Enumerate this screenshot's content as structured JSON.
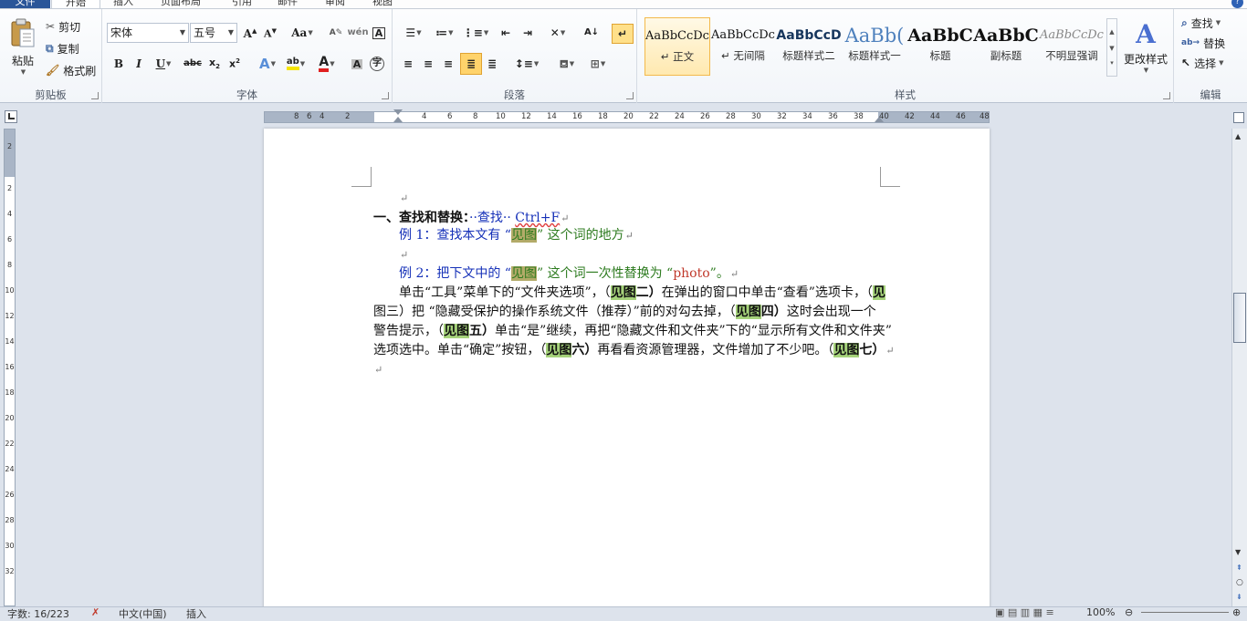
{
  "tabs": {
    "file": "文件",
    "home": "开始",
    "insert": "插入",
    "layout": "页面布局",
    "references": "引用",
    "mailings": "邮件",
    "review": "审阅",
    "view": "视图"
  },
  "clipboard": {
    "label": "剪贴板",
    "paste": "粘贴",
    "cut": "剪切",
    "copy": "复制",
    "format_painter": "格式刷"
  },
  "font": {
    "label": "字体",
    "name": "宋体",
    "size": "五号"
  },
  "paragraph": {
    "label": "段落"
  },
  "styles": {
    "label": "样式",
    "preview_text": [
      "AaBbCcDc",
      "AaBbCcDc",
      "AaBbCcD",
      "AaBb(",
      "AaBbC",
      "AaBbC",
      "AaBbCcDc"
    ],
    "names": [
      "↵ 正文",
      "↵ 无间隔",
      "标题样式二",
      "标题样式一",
      "标题",
      "副标题",
      "不明显强调"
    ],
    "change": "更改样式"
  },
  "editing": {
    "label": "编辑",
    "find": "查找",
    "replace": "替换",
    "select": "选择"
  },
  "doc": {
    "heading": "一、查找和替换：",
    "find_label": "查找",
    "shortcut": "Ctrl+F",
    "ex1_a": "例 1：查找本文有 “",
    "ex1_b": "见图",
    "ex1_c": "” 这个词的地方",
    "ex2_a": "例 2：把下文中的 “",
    "ex2_b": "见图",
    "ex2_c": "” 这个词一次性替换为 “",
    "ex2_d": "photo",
    "ex2_e": "”。",
    "p1_a": "单击“工具”菜单下的“文件夹选项”，（",
    "see": "见图",
    "n2": "二）",
    "p1_b": "在弹出的窗口中单击“查看”选项卡，（",
    "p2_a": "图三）把 “隐藏受保护的操作系统文件（推荐）”前的对勾去掉，（",
    "n4": "四）",
    "p2_b": "这时会出现一个",
    "p3_a": "警告提示，（",
    "n5": "五）",
    "p3_b": "单击“是”继续，再把“隐藏文件和文件夹”下的“显示所有文件和文件夹”",
    "p4_a": "选项选中。单击“确定”按钮，（",
    "n6": "六）",
    "p4_b": "再看看资源管理器，文件增加了不少吧。（",
    "n7": "七）",
    "see_start": "见"
  },
  "status": {
    "words": "字数: 16/223",
    "language": "中文(中国)",
    "insert": "插入",
    "zoom": "100%"
  }
}
